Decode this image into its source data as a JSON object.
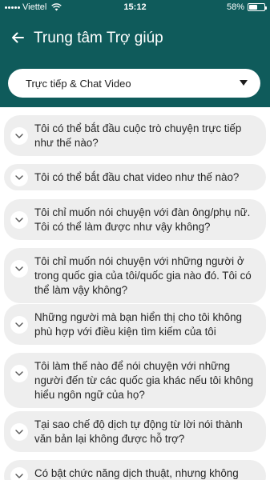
{
  "status_bar": {
    "carrier": "Viettel",
    "time": "15:12",
    "battery_percent_label": "58%",
    "battery_level": 0.58
  },
  "header": {
    "title": "Trung tâm Trợ giúp",
    "back_icon": "arrow-left-icon"
  },
  "dropdown": {
    "selected": "Trực tiếp & Chat Video",
    "icon": "triangle-down-icon"
  },
  "faq": {
    "items": [
      {
        "question": "Tôi có thể bắt đầu cuộc trò chuyện trực tiếp như thế nào?"
      },
      {
        "question": "Tôi có thể bắt đầu chat video như thế nào?"
      },
      {
        "question": "Tôi chỉ muốn nói chuyện với đàn ông/phụ nữ. Tôi có thể làm được như vậy không?"
      },
      {
        "question": "Tôi chỉ muốn nói chuyện với những người ở trong quốc gia của tôi/quốc gia nào đó. Tôi có thể làm vậy không?"
      },
      {
        "question": "Những người mà bạn hiển thị cho tôi không phù hợp với điều kiện tìm kiếm của tôi"
      },
      {
        "question": "Tôi làm thế nào để nói chuyện với những người đến từ các quốc gia khác nếu tôi không hiểu ngôn ngữ của họ?"
      },
      {
        "question": "Tại sao chế độ dịch tự động từ lời nói thành văn bản lại không được hỗ trợ?"
      },
      {
        "question": "Có bật chức năng dịch thuật, nhưng không"
      }
    ]
  },
  "colors": {
    "header_bg": "#0f5b5b",
    "item_bg": "#eeeeee",
    "text": "#262626"
  }
}
